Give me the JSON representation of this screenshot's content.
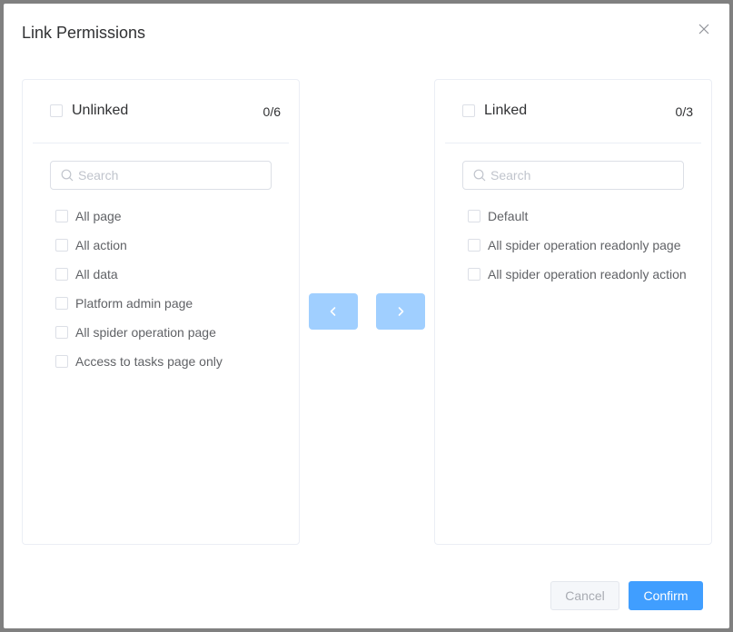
{
  "dialog": {
    "title": "Link Permissions"
  },
  "unlinked": {
    "title": "Unlinked",
    "count": "0/6",
    "search_placeholder": "Search",
    "items": [
      {
        "label": "All page"
      },
      {
        "label": "All action"
      },
      {
        "label": "All data"
      },
      {
        "label": "Platform admin page"
      },
      {
        "label": "All spider operation page"
      },
      {
        "label": "Access to tasks page only"
      }
    ]
  },
  "linked": {
    "title": "Linked",
    "count": "0/3",
    "search_placeholder": "Search",
    "items": [
      {
        "label": "Default"
      },
      {
        "label": "All spider operation readonly page"
      },
      {
        "label": "All spider operation readonly action"
      }
    ]
  },
  "buttons": {
    "move_left_icon": "chevron-left-icon",
    "move_right_icon": "chevron-right-icon",
    "cancel": "Cancel",
    "confirm": "Confirm"
  },
  "colors": {
    "primary": "#409eff",
    "transfer_disabled": "#a0cfff",
    "border": "#ebeef5"
  }
}
